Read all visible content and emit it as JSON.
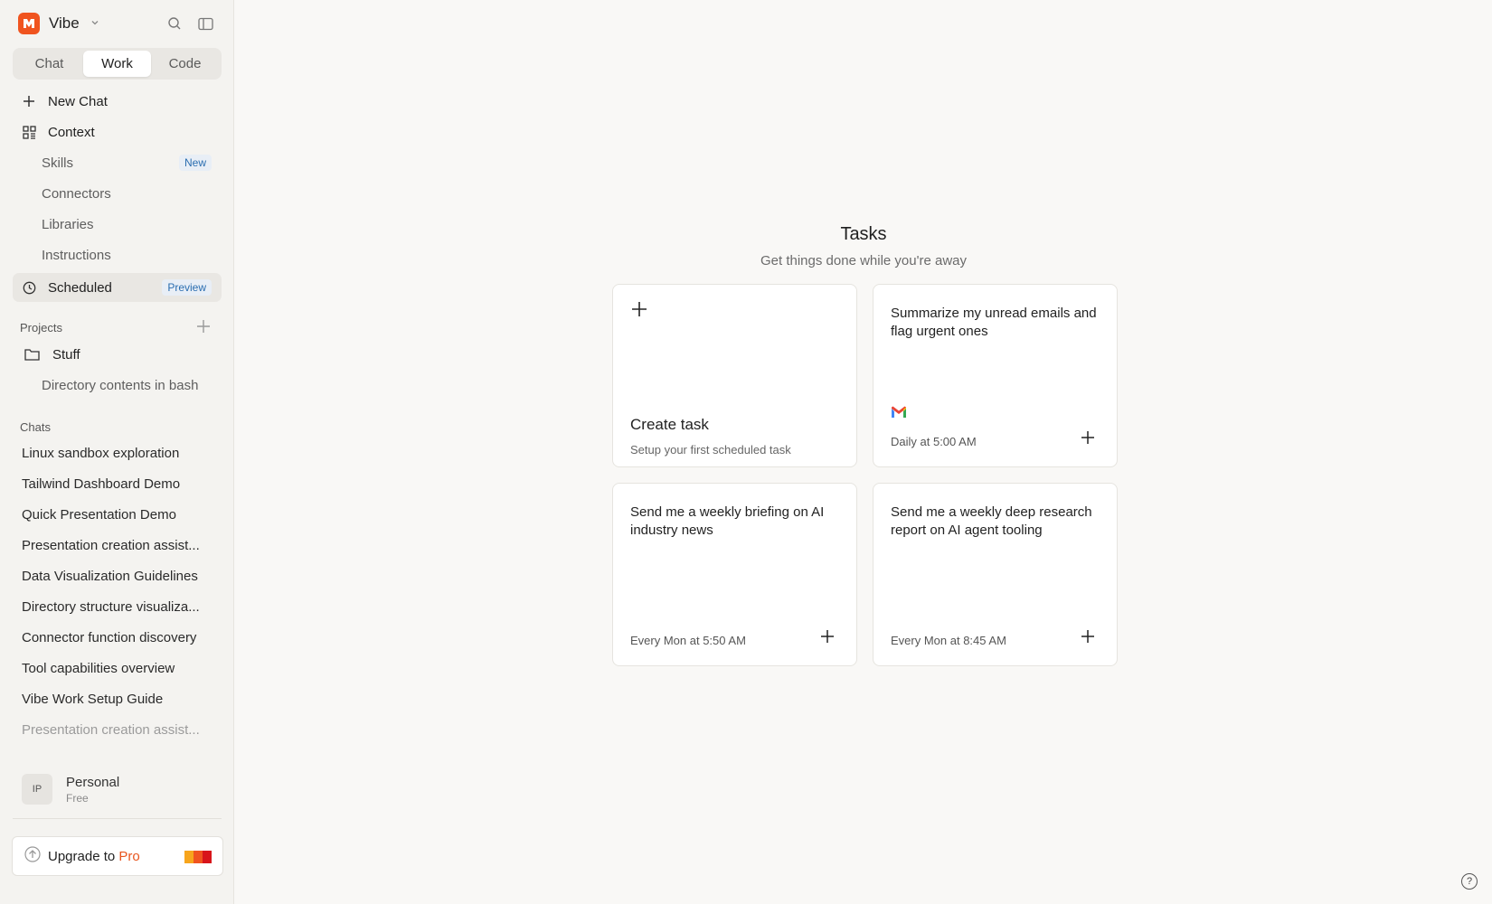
{
  "app": {
    "name": "Vibe"
  },
  "tabs": [
    {
      "label": "Chat"
    },
    {
      "label": "Work"
    },
    {
      "label": "Code"
    }
  ],
  "nav": {
    "new_chat": "New Chat",
    "context": "Context",
    "skills": "Skills",
    "skills_badge": "New",
    "connectors": "Connectors",
    "libraries": "Libraries",
    "instructions": "Instructions",
    "scheduled": "Scheduled",
    "scheduled_badge": "Preview"
  },
  "projects": {
    "label": "Projects",
    "items": [
      {
        "name": "Stuff",
        "children": [
          "Directory contents in bash"
        ]
      }
    ]
  },
  "chats": {
    "label": "Chats",
    "items": [
      "Linux sandbox exploration",
      "Tailwind Dashboard Demo",
      "Quick Presentation Demo",
      "Presentation creation assist...",
      "Data Visualization Guidelines",
      "Directory structure visualiza...",
      "Connector function discovery",
      "Tool capabilities overview",
      "Vibe Work Setup Guide",
      "Presentation creation assist..."
    ]
  },
  "account": {
    "initials": "IP",
    "name": "Personal",
    "plan": "Free"
  },
  "upgrade": {
    "prefix": "Upgrade to",
    "highlight": "Pro"
  },
  "main": {
    "title": "Tasks",
    "subtitle": "Get things done while you're away",
    "create": {
      "title": "Create task",
      "subtitle": "Setup your first scheduled task"
    },
    "cards": [
      {
        "title": "Summarize my unread emails and flag urgent ones",
        "schedule": "Daily at 5:00 AM",
        "icon": "gmail-icon"
      },
      {
        "title": "Send me a weekly briefing on AI industry news",
        "schedule": "Every Mon at 5:50 AM"
      },
      {
        "title": "Send me a weekly deep research report on AI agent tooling",
        "schedule": "Every Mon at 8:45 AM"
      }
    ]
  },
  "help": {
    "glyph": "?"
  },
  "colors": {
    "brand": "#f0541f",
    "accent_blue": "#2a6db0",
    "pro": "#e8551e"
  }
}
